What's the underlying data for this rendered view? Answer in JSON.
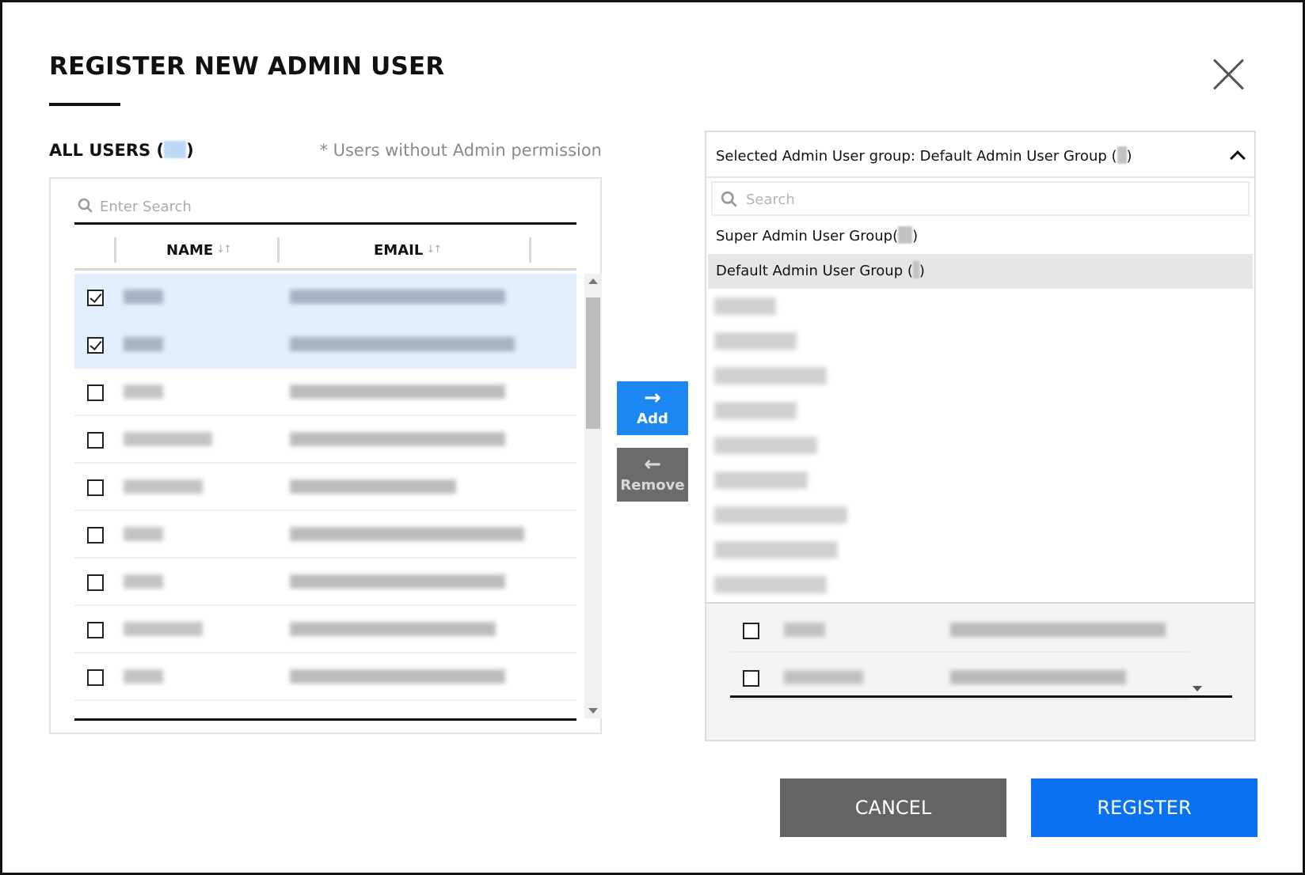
{
  "dialog": {
    "title": "REGISTER NEW ADMIN USER",
    "close_icon": "close-icon"
  },
  "all_users": {
    "heading_prefix": "ALL USERS (",
    "heading_suffix": ")",
    "note": "* Users without Admin permission",
    "search_placeholder": "Enter Search",
    "columns": {
      "name": "NAME",
      "email": "EMAIL",
      "sort_icon": "sort-arrows-icon"
    },
    "rows": [
      {
        "checked": true
      },
      {
        "checked": true
      },
      {
        "checked": false
      },
      {
        "checked": false
      },
      {
        "checked": false
      },
      {
        "checked": false
      },
      {
        "checked": false
      },
      {
        "checked": false
      },
      {
        "checked": false
      }
    ]
  },
  "transfer": {
    "add_label": "Add",
    "add_arrow": "→",
    "remove_label": "Remove",
    "remove_arrow": "←"
  },
  "admin_group": {
    "selected_prefix": "Selected Admin User group: Default Admin User Group (",
    "selected_suffix": ")",
    "search_placeholder": "Search",
    "options": [
      {
        "label_prefix": "Super Admin User Group(",
        "label_suffix": ")"
      },
      {
        "label_prefix": "Default Admin User Group (",
        "label_suffix": ")",
        "active": true
      }
    ],
    "rows": [
      {
        "checked": false
      },
      {
        "checked": false
      }
    ]
  },
  "footer": {
    "cancel_label": "CANCEL",
    "register_label": "REGISTER"
  },
  "colors": {
    "primary_blue": "#0a72f0",
    "add_blue": "#1c87f2",
    "gray_button": "#646464",
    "selected_row": "#e3eefc"
  }
}
